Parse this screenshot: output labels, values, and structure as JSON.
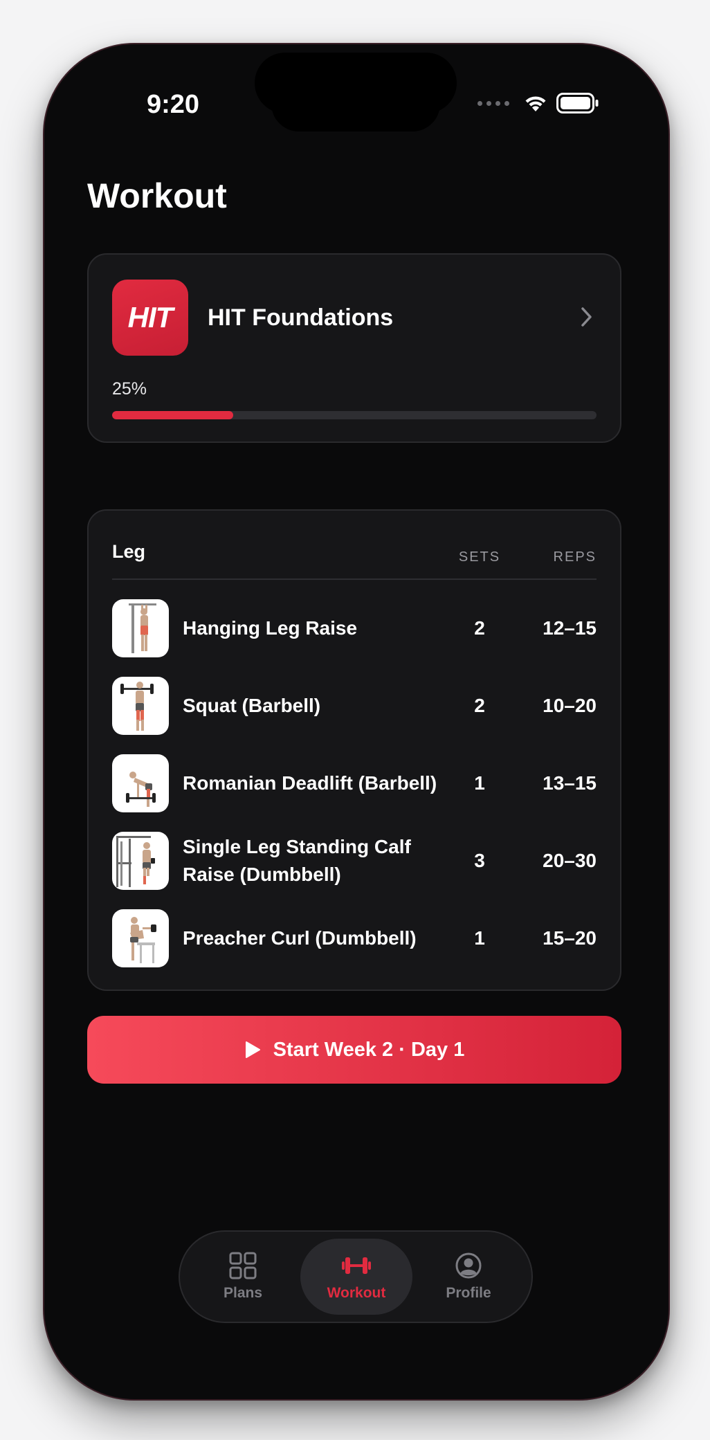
{
  "status_bar": {
    "time": "9:20"
  },
  "page": {
    "title": "Workout"
  },
  "plan": {
    "logo_text": "HIT",
    "name": "HIT Foundations",
    "progress_label": "25%",
    "progress_fraction": 0.25,
    "accent_color": "#e12b40"
  },
  "workout": {
    "group_label": "Leg",
    "columns": {
      "sets": "SETS",
      "reps": "REPS"
    },
    "exercises": [
      {
        "name": "Hanging Leg Raise",
        "sets": "2",
        "reps": "12–15",
        "icon": "hanging-leg-raise-thumbnail"
      },
      {
        "name": "Squat (Barbell)",
        "sets": "2",
        "reps": "10–20",
        "icon": "barbell-squat-thumbnail"
      },
      {
        "name": "Romanian Deadlift (Barbell)",
        "sets": "1",
        "reps": "13–15",
        "icon": "romanian-deadlift-thumbnail"
      },
      {
        "name": "Single Leg Standing Calf Raise (Dumbbell)",
        "sets": "3",
        "reps": "20–30",
        "icon": "calf-raise-thumbnail"
      },
      {
        "name": "Preacher Curl (Dumbbell)",
        "sets": "1",
        "reps": "15–20",
        "icon": "preacher-curl-thumbnail"
      }
    ]
  },
  "start_button": {
    "label": "Start Week 2 · Day 1"
  },
  "tabbar": {
    "items": [
      {
        "label": "Plans",
        "icon": "grid-icon",
        "active": false
      },
      {
        "label": "Workout",
        "icon": "dumbbell-icon",
        "active": true
      },
      {
        "label": "Profile",
        "icon": "person-circle-icon",
        "active": false
      }
    ],
    "active_color": "#e12b40",
    "inactive_color": "#7d7d83"
  }
}
